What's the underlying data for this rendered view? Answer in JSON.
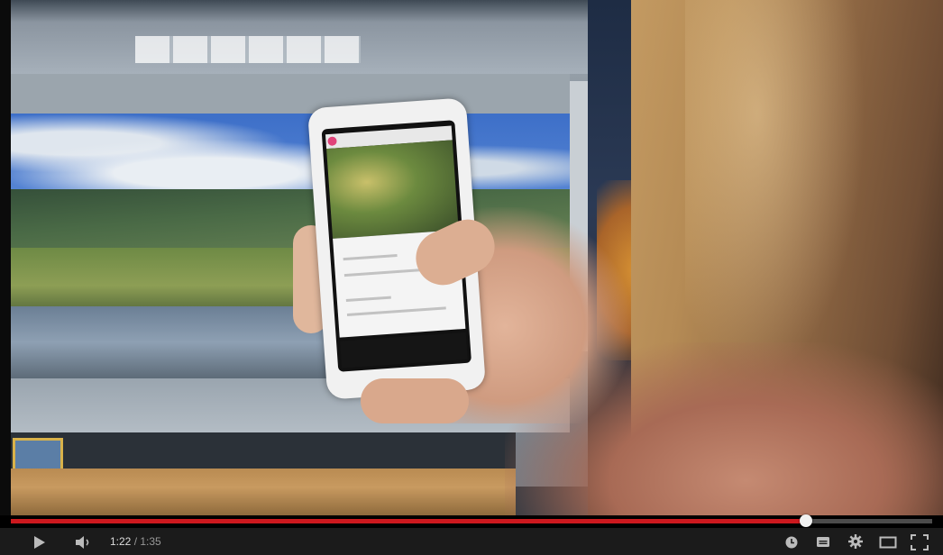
{
  "player": {
    "time": {
      "current": "1:22",
      "separator": " / ",
      "duration": "1:35"
    },
    "progress": {
      "played_fraction": 0.8632
    },
    "buttons": {
      "play": "play-icon",
      "volume": "volume-icon",
      "watch_later": "clock-icon",
      "captions": "captions-icon",
      "settings": "gear-icon",
      "theater": "theater-mode-icon",
      "fullscreen": "fullscreen-icon"
    },
    "colors": {
      "progress_played": "#cc181e",
      "progress_track": "#4b4b4b",
      "controls_bg": "#1b1b1b",
      "icon": "#bbbbbb"
    }
  }
}
